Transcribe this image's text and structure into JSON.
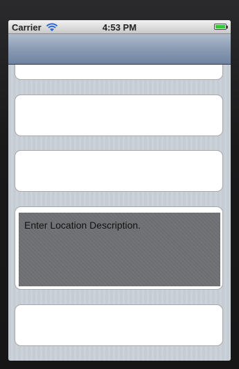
{
  "status_bar": {
    "carrier": "Carrier",
    "time": "4:53 PM",
    "wifi_icon": "wifi-icon",
    "battery_icon": "battery-icon",
    "battery_level": 1.0,
    "battery_color": "#36c83a"
  },
  "nav_bar": {
    "title": ""
  },
  "form": {
    "cells": [
      {
        "value": ""
      },
      {
        "value": ""
      },
      {
        "value": ""
      },
      {
        "value": "Enter Location Description."
      },
      {
        "value": ""
      }
    ]
  },
  "colors": {
    "nav_bar": "#8a9bb3",
    "background": "#c5ccd4",
    "textview_bg": "#6d6e72"
  }
}
